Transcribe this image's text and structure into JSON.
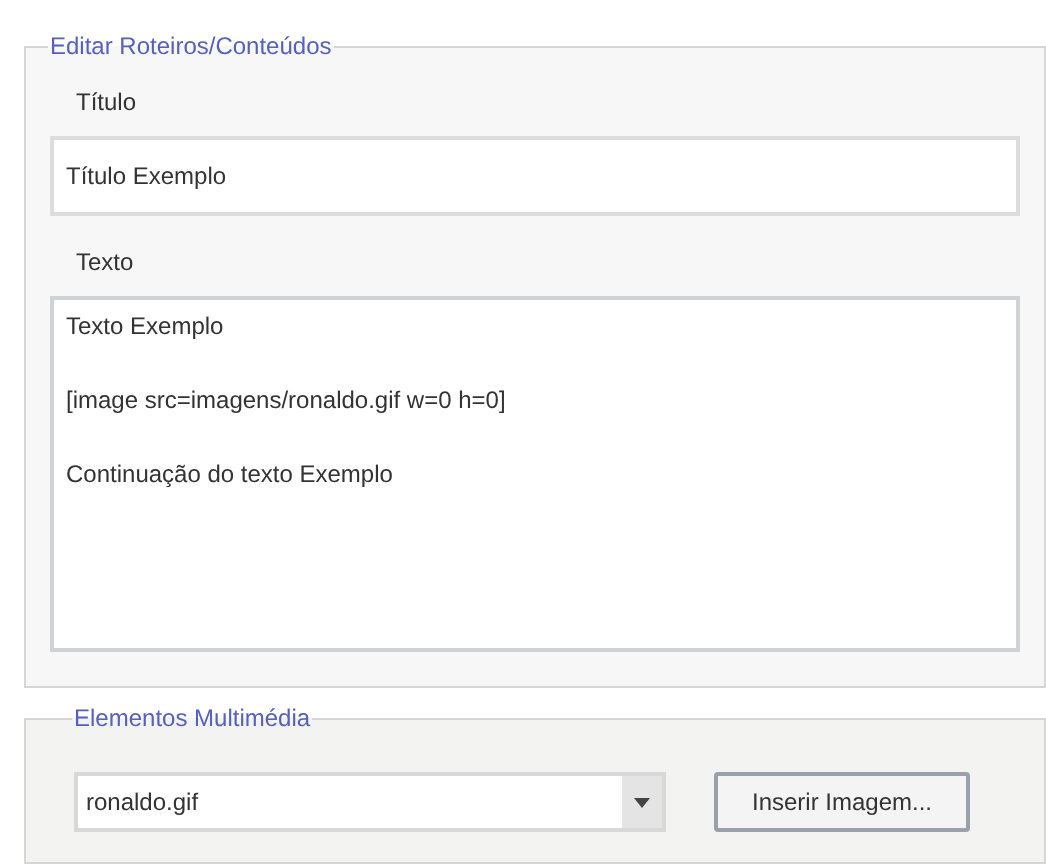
{
  "editor": {
    "legend": "Editar Roteiros/Conteúdos",
    "title_label": "Título",
    "title_value": "Título Exemplo",
    "text_label": "Texto",
    "text_lines": [
      "Texto Exemplo",
      "[image src=imagens/ronaldo.gif w=0 h=0]",
      "Continuação do texto Exemplo"
    ]
  },
  "multimedia": {
    "legend": "Elementos Multimédia",
    "combo_value": "ronaldo.gif",
    "button": "Inserir Imagem..."
  }
}
